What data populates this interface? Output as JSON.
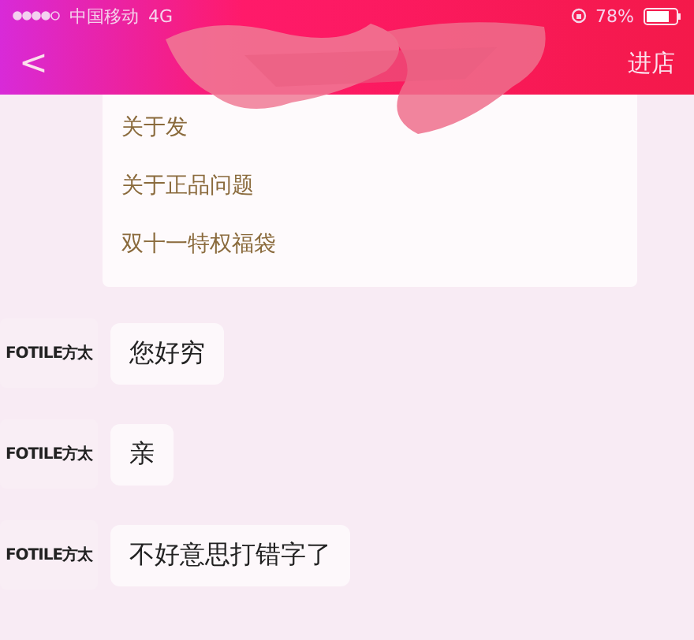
{
  "status_bar": {
    "carrier": "中国移动",
    "network": "4G",
    "battery": "78%"
  },
  "nav_bar": {
    "back": "<",
    "action": "进店"
  },
  "menu": {
    "items": [
      "关于发",
      "关于正品问题",
      "双十一特权福袋"
    ]
  },
  "messages": [
    {
      "avatar": "FOTILE方太",
      "text": "您好穷"
    },
    {
      "avatar": "FOTILE方太",
      "text": "亲"
    },
    {
      "avatar": "FOTILE方太",
      "text": "不好意思打错字了"
    }
  ]
}
